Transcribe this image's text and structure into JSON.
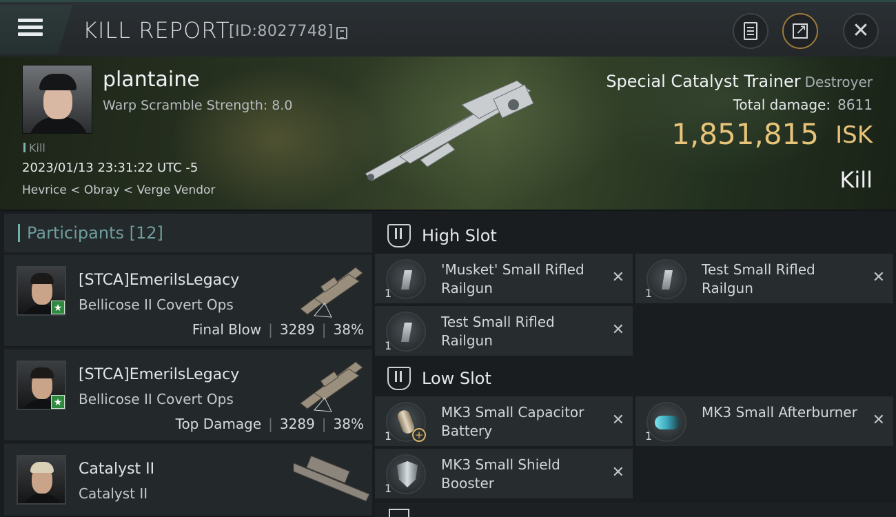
{
  "header": {
    "title": "KILL REPORT",
    "report_id": "[ID:8027748]"
  },
  "victim": {
    "pilot_name": "plantaine",
    "warp_scramble": "Warp Scramble Strength: 8.0",
    "kill_tag": "Kill",
    "datetime": "2023/01/13 23:31:22 UTC -5",
    "location": "Hevrice < Obray < Verge Vendor",
    "ship_name": "Special Catalyst Trainer",
    "ship_class": "Destroyer",
    "total_damage_label": "Total damage:",
    "total_damage_value": "8611",
    "isk_value": "1,851,815",
    "isk_unit": "ISK",
    "result": "Kill"
  },
  "participants": {
    "label": "Participants",
    "count": "[12]",
    "rows": [
      {
        "name": "[STCA]EmerilsLegacy",
        "ship": "Bellicose II Covert Ops",
        "role": "Final Blow",
        "damage": "3289",
        "percent": "38%",
        "badge": "★"
      },
      {
        "name": "[STCA]EmerilsLegacy",
        "ship": "Bellicose II Covert Ops",
        "role": "Top Damage",
        "damage": "3289",
        "percent": "38%",
        "badge": "★"
      },
      {
        "name": "Catalyst II",
        "ship": "Catalyst II"
      }
    ]
  },
  "fitting": {
    "high_slot_label": "High Slot",
    "low_slot_label": "Low Slot",
    "high": [
      {
        "qty": "1",
        "name": "'Musket' Small Rifled Railgun",
        "icon": "railgun-icon"
      },
      {
        "qty": "1",
        "name": "Test Small Rifled Railgun",
        "icon": "railgun-icon"
      },
      {
        "qty": "1",
        "name": "Test Small Rifled Railgun",
        "icon": "railgun-icon"
      }
    ],
    "low": [
      {
        "qty": "1",
        "name": "MK3 Small Capacitor Battery",
        "icon": "capacitor-battery-icon"
      },
      {
        "qty": "1",
        "name": "MK3 Small Afterburner",
        "icon": "afterburner-icon"
      },
      {
        "qty": "1",
        "name": "MK3 Small Shield Booster",
        "icon": "shield-booster-icon"
      }
    ],
    "remove_glyph": "✕"
  },
  "colors": {
    "accent_teal": "#6fb2ad",
    "isk_gold": "#e8c47a",
    "panel": "#23282b"
  }
}
